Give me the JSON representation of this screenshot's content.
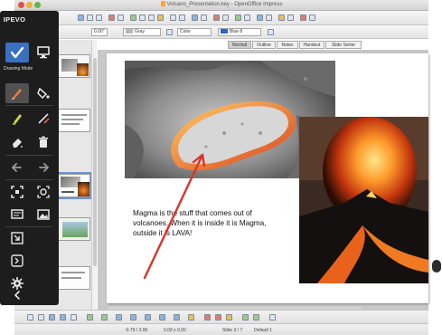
{
  "window": {
    "title": "Volcano_Presentation.key - OpenOffice Impress"
  },
  "toolbar": {
    "zoom_value": "0.00\"",
    "line_color": "Gray",
    "area_type": "Color",
    "area_color": "Blue 8"
  },
  "view_tabs": [
    "Normal",
    "Outline",
    "Notes",
    "Handout",
    "Slide Sorter"
  ],
  "slide": {
    "caption_line1": "Magma is the stuff that comes out of",
    "caption_line2": "volcanoes. When it is inside it is Magma,",
    "caption_line3": "outside it is LAVA!"
  },
  "status": {
    "position": "-0.79 / 2.90",
    "size": "0.00 x 0.00",
    "slide": "Slide 3 / 7",
    "layout": "Default 1"
  },
  "ipevo": {
    "logo": "IPEVO",
    "mode_label": "Drawing Mode",
    "tools": [
      "cursor-icon",
      "desktop-icon",
      "pen-icon",
      "fill-icon",
      "highlighter-icon",
      "line-icon",
      "eraser-icon",
      "trash-icon",
      "undo-icon",
      "redo-icon",
      "screenshot-icon",
      "camera-icon",
      "whiteboard-icon",
      "image-icon",
      "minimize-icon",
      "fit-icon",
      "settings-icon",
      "collapse-icon"
    ]
  },
  "colors": {
    "ipevo_bg": "#1d1d1d",
    "ipevo_active": "#3a6fc2",
    "annotation_arrow": "#d9342b",
    "lava": "#f06a1f"
  }
}
